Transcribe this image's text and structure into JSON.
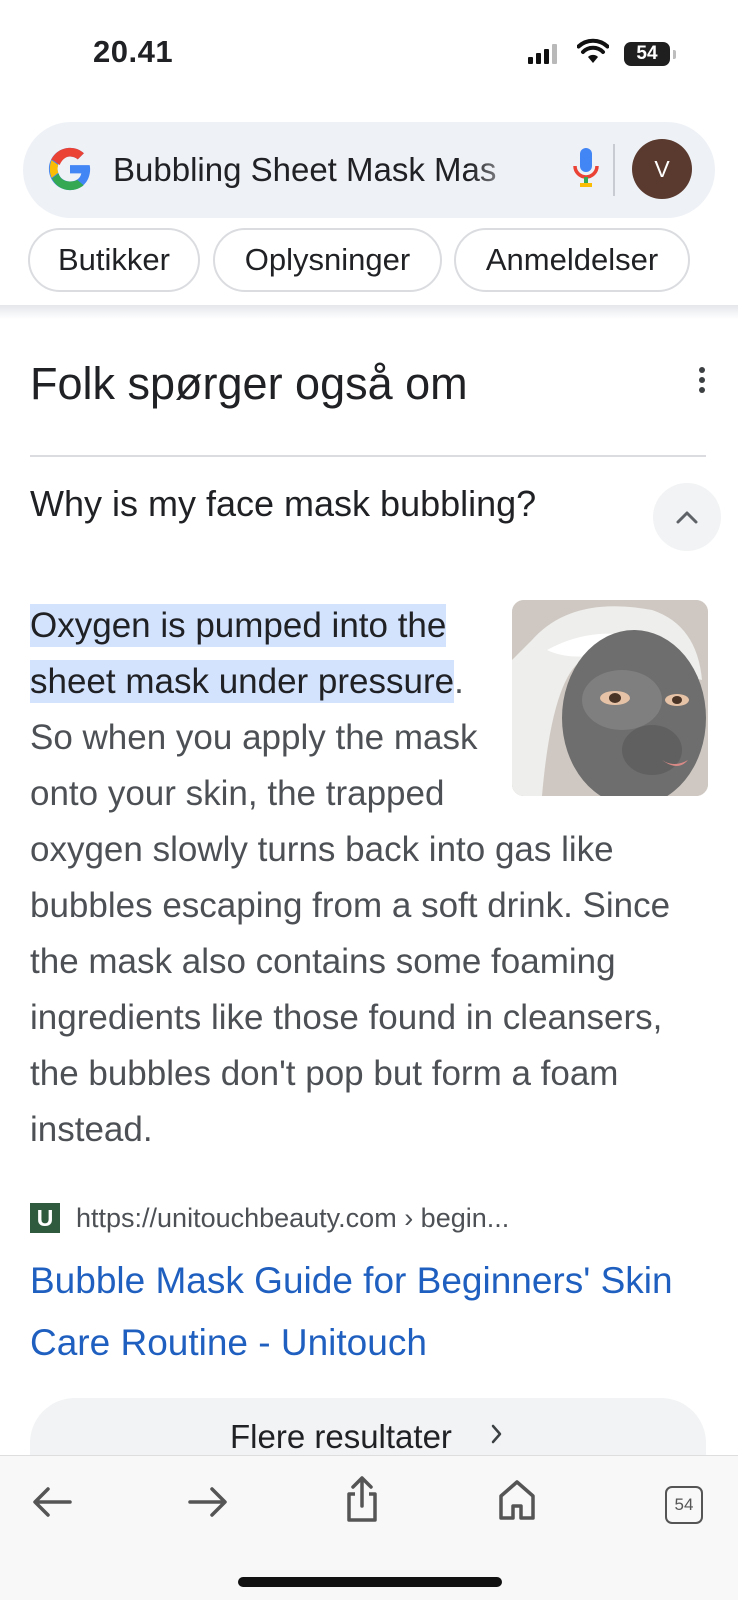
{
  "status_bar": {
    "time": "20.41",
    "battery": "54"
  },
  "search": {
    "query": "Bubbling Sheet Mask Mas",
    "avatar_letter": "V"
  },
  "chips": [
    {
      "label": "Butikker"
    },
    {
      "label": "Oplysninger"
    },
    {
      "label": "Anmeldelser"
    }
  ],
  "section": {
    "title": "Folk spørger også om"
  },
  "question": {
    "text": "Why is my face mask bubbling?"
  },
  "answer": {
    "highlight": "Oxygen is pumped into the sheet mask under pressure",
    "rest": ". So when you apply the mask onto your skin, the trapped oxygen slowly turns back into gas like bubbles escaping from a soft drink. Since the mask also contains some foaming ingredients like those found in cleansers, the bubbles don't pop but form a foam instead."
  },
  "source": {
    "favicon_letter": "U",
    "url": "https://unitouchbeauty.com › begin...",
    "title": "Bubble Mask Guide for Beginners' Skin Care Routine - Unitouch"
  },
  "more_results": {
    "label": "Flere resultater"
  },
  "toolbar": {
    "tab_count": "54"
  },
  "colors": {
    "link": "#1f5fbf",
    "highlight": "#d3e3fd",
    "pill_bg": "#eef1f6",
    "avatar": "#5a3a2e"
  }
}
